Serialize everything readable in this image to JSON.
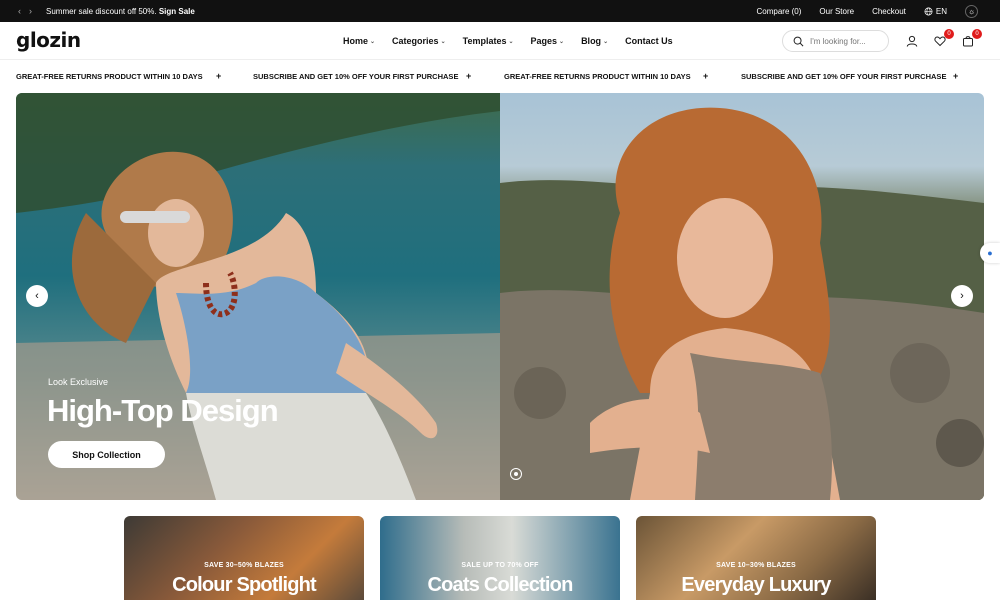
{
  "topbar": {
    "prev_icon": "chevron-left-icon",
    "next_icon": "chevron-right-icon",
    "promo_text": "Summer sale discount off 50%.",
    "promo_link": "Sign Sale",
    "compare": "Compare (0)",
    "our_store": "Our Store",
    "checkout": "Checkout",
    "language": "EN",
    "background": "#111111"
  },
  "header": {
    "logo": "glozin",
    "nav": [
      {
        "label": "Home",
        "has_dropdown": true
      },
      {
        "label": "Categories",
        "has_dropdown": true
      },
      {
        "label": "Templates",
        "has_dropdown": true
      },
      {
        "label": "Pages",
        "has_dropdown": true
      },
      {
        "label": "Blog",
        "has_dropdown": true
      },
      {
        "label": "Contact Us",
        "has_dropdown": false
      }
    ],
    "search_placeholder": "I'm looking for...",
    "wishlist_count": "0",
    "cart_count": "0",
    "badge_color": "#e01b1b"
  },
  "marquee": {
    "items": [
      "GREAT-FREE RETURNS PRODUCT WITHIN 10 DAYS",
      "SUBSCRIBE AND GET 10% OFF YOUR FIRST PURCHASE",
      "GREAT-FREE RETURNS PRODUCT WITHIN 10 DAYS",
      "SUBSCRIBE AND GET 10% OFF YOUR FIRST PURCHASE"
    ],
    "separator": "+"
  },
  "hero": {
    "eyebrow": "Look Exclusive",
    "title": "High-Top Design",
    "cta": "Shop Collection"
  },
  "collections": [
    {
      "subtitle": "SAVE 30–50% BLAZES",
      "title": "Colour Spotlight"
    },
    {
      "subtitle": "SALE UP TO 70% OFF",
      "title": "Coats Collection"
    },
    {
      "subtitle": "SAVE 10–30% BLAZES",
      "title": "Everyday Luxury"
    }
  ]
}
